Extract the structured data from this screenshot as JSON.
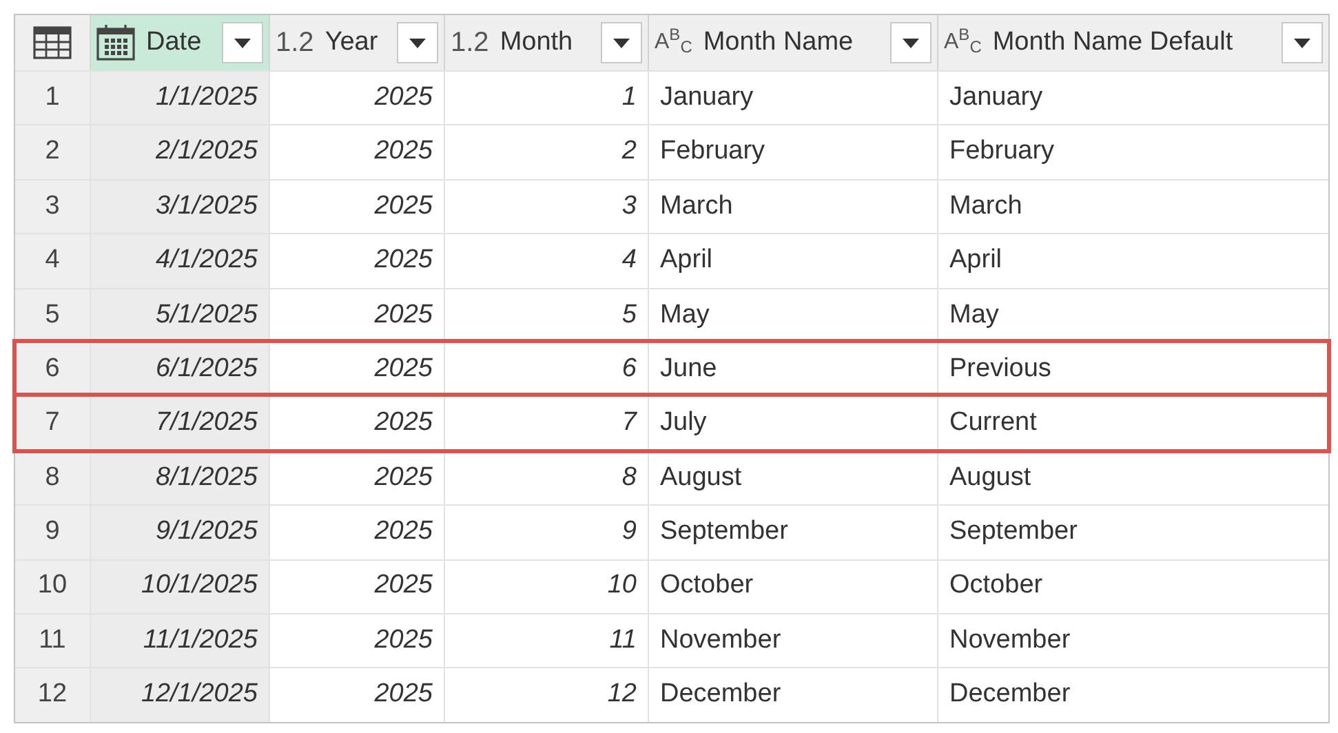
{
  "columns": [
    {
      "name": "Date",
      "kind": "date",
      "selected": true
    },
    {
      "name": "Year",
      "kind": "number",
      "type_label": "1.2",
      "selected": false
    },
    {
      "name": "Month",
      "kind": "number",
      "type_label": "1.2",
      "selected": false
    },
    {
      "name": "Month Name",
      "kind": "text",
      "type_label": "A$^{B}$$_{C}$",
      "selected": false
    },
    {
      "name": "Month Name Default",
      "kind": "text",
      "type_label": "A$^{B}$$_{C}$",
      "selected": false
    }
  ],
  "rows": [
    {
      "number": "1",
      "cells": [
        "1/1/2025",
        "2025",
        "1",
        "January",
        "January"
      ],
      "highlighted": false
    },
    {
      "number": "2",
      "cells": [
        "2/1/2025",
        "2025",
        "2",
        "February",
        "February"
      ],
      "highlighted": false
    },
    {
      "number": "3",
      "cells": [
        "3/1/2025",
        "2025",
        "3",
        "March",
        "March"
      ],
      "highlighted": false
    },
    {
      "number": "4",
      "cells": [
        "4/1/2025",
        "2025",
        "4",
        "April",
        "April"
      ],
      "highlighted": false
    },
    {
      "number": "5",
      "cells": [
        "5/1/2025",
        "2025",
        "5",
        "May",
        "May"
      ],
      "highlighted": false
    },
    {
      "number": "6",
      "cells": [
        "6/1/2025",
        "2025",
        "6",
        "June",
        "Previous"
      ],
      "highlighted": true
    },
    {
      "number": "7",
      "cells": [
        "7/1/2025",
        "2025",
        "7",
        "July",
        "Current"
      ],
      "highlighted": true
    },
    {
      "number": "8",
      "cells": [
        "8/1/2025",
        "2025",
        "8",
        "August",
        "August"
      ],
      "highlighted": false
    },
    {
      "number": "9",
      "cells": [
        "9/1/2025",
        "2025",
        "9",
        "September",
        "September"
      ],
      "highlighted": false
    },
    {
      "number": "10",
      "cells": [
        "10/1/2025",
        "2025",
        "10",
        "October",
        "October"
      ],
      "highlighted": false
    },
    {
      "number": "11",
      "cells": [
        "11/1/2025",
        "2025",
        "11",
        "November",
        "November"
      ],
      "highlighted": false
    },
    {
      "number": "12",
      "cells": [
        "12/1/2025",
        "2025",
        "12",
        "December",
        "December"
      ],
      "highlighted": false
    }
  ]
}
